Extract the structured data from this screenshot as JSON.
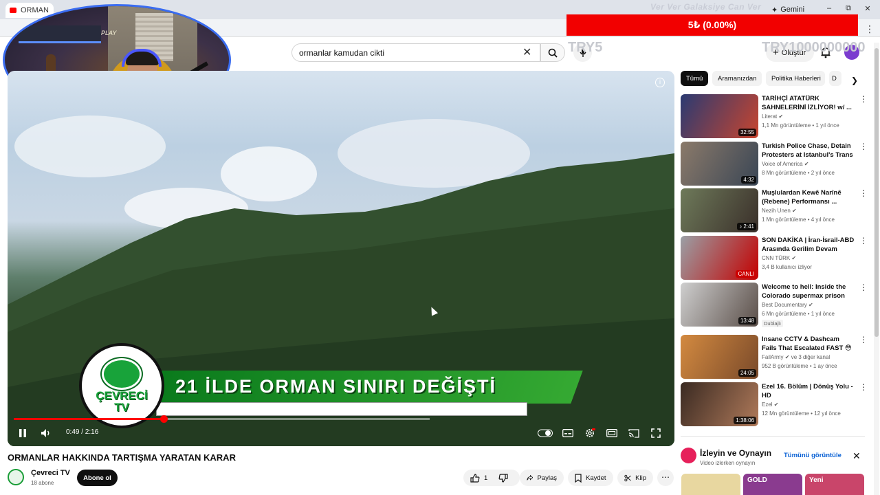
{
  "browser": {
    "tab_title": "ORMAN",
    "gemini_label": "Gemini",
    "minimize": "–",
    "restore": "⧉",
    "close": "✕",
    "menu": "⋮"
  },
  "overlay": {
    "stream_title": "Ver Ver Galaksiye Can Ver",
    "donation": "5₺ (0.00%)",
    "ghost_left": "TRY5",
    "ghost_right": "TRY1000000000"
  },
  "header": {
    "search_value": "ormanlar kamudan cikti",
    "create_label": "Oluştur"
  },
  "webcam": {
    "sign": "PLAY"
  },
  "player": {
    "headline": "21 İLDE ORMAN SINIRI DEĞİŞTİ",
    "logo_line1": "ÇEVRECİ",
    "logo_line2": "TV",
    "current_time": "0:49",
    "duration": "2:16",
    "progress": 0.36,
    "buffered": 1.0,
    "time_display": "0:49 / 2:16"
  },
  "video": {
    "title": "ORMANLAR HAKKINDA TARTIŞMA YARATAN KARAR",
    "channel": "Çevreci TV",
    "subscribers": "18 abone",
    "subscribe_label": "Abone ol",
    "like_count": "1",
    "share_label": "Paylaş",
    "save_label": "Kaydet",
    "clip_label": "Klip",
    "more": "⋯"
  },
  "chips": [
    "Tümü",
    "Aramanızdan",
    "Politika Haberleri",
    "D"
  ],
  "recommendations": [
    {
      "title": "TARİHÇİ ATATÜRK SAHNELERİNİ İZLİYOR! w/ ...",
      "channel": "Literat ✔",
      "meta": "1,1 Mn görüntüleme • 1 yıl önce",
      "duration": "32:55",
      "color_a": "#2a3a72",
      "color_b": "#c8452f"
    },
    {
      "title": "Turkish Police Chase, Detain Protesters at Istanbul's Trans ...",
      "channel": "Voice of America ✔",
      "meta": "8 Mn görüntüleme • 2 yıl önce",
      "duration": "4:32",
      "color_a": "#8b7a6a",
      "color_b": "#3a4655"
    },
    {
      "title": "Muşlulardan Kewê Narînê (Rebene) Performansı ...",
      "channel": "Nezih Unen ✔",
      "meta": "1 Mn görüntüleme • 4 yıl önce",
      "duration": "♪ 2:41",
      "color_a": "#6e7a5a",
      "color_b": "#3a2f2a"
    },
    {
      "title": "SON DAKİKA | İran-İsrail-ABD Arasında Gerilim Devam Ediyo...",
      "channel": "CNN TÜRK ✔",
      "meta": "3,4 B kullanıcı izliyor",
      "duration": "CANLI",
      "color_a": "#9aa0a6",
      "color_b": "#c40000"
    },
    {
      "title": "Welcome to hell: Inside the Colorado supermax prison",
      "channel": "Best Documentary ✔",
      "meta": "6 Mn görüntüleme • 1 yıl önce",
      "duration": "13:48",
      "badge": "Dublajlı",
      "color_a": "#cfcfcf",
      "color_b": "#5a4e48"
    },
    {
      "title": "Insane CCTV & Dashcam Fails That Escalated FAST 😳📹",
      "channel": "FailArmy ✔ ve 3 diğer kanal",
      "meta": "952 B görüntüleme • 1 ay önce",
      "duration": "24:05",
      "color_a": "#d38a40",
      "color_b": "#7a4a2a"
    },
    {
      "title": "Ezel 16. Bölüm | Dönüş Yolu - HD",
      "channel": "Ezel ✔",
      "meta": "12 Mn görüntüleme • 12 yıl önce",
      "duration": "1:38:06",
      "color_a": "#3a2a22",
      "color_b": "#b07a5a"
    }
  ],
  "playables": {
    "title": "İzleyin ve Oynayın",
    "subtitle": "Video izlerken oynayın",
    "view_all": "Tümünü görüntüle",
    "close": "✕",
    "games": [
      {
        "label": "",
        "color": "#e8d7a0"
      },
      {
        "label": "GOLD",
        "color": "#8a3b8f"
      },
      {
        "label": "Yeni",
        "color": "#c9456a"
      }
    ]
  },
  "colors": {
    "accent_red": "#ff0000",
    "donation_red": "#f20000",
    "logo_green": "#19a43b",
    "link_blue": "#065fd4"
  }
}
